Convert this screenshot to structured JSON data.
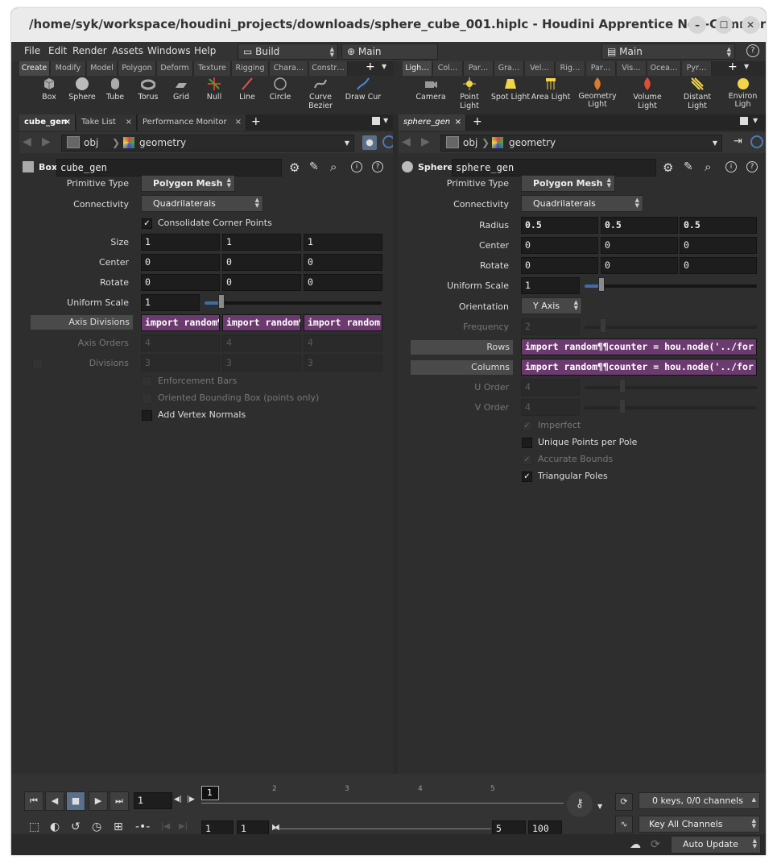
{
  "window": {
    "title": "/home/syk/workspace/houdini_projects/downloads/sphere_cube_001.hiplc - Houdini Apprentice Non-Commerci…",
    "minimize": "–",
    "maximize": "☐",
    "close": "✕"
  },
  "menu": [
    "File",
    "Edit",
    "Render",
    "Assets",
    "Windows",
    "Help"
  ],
  "desktop": "Build",
  "context": "Main",
  "context_right": "Main",
  "shelf_left": {
    "tabs": [
      "Create",
      "Modify",
      "Model",
      "Polygon",
      "Deform",
      "Texture",
      "Rigging",
      "Chara…",
      "Constr…"
    ],
    "tools": [
      "Box",
      "Sphere",
      "Tube",
      "Torus",
      "Grid",
      "Null",
      "Line",
      "Circle",
      "Curve Bezier",
      "Draw Cur"
    ]
  },
  "shelf_right": {
    "tabs": [
      "Ligh…",
      "Col…",
      "Par…",
      "Gra…",
      "Vel…",
      "Rig…",
      "Par…",
      "Vis…",
      "Ocea…",
      "Pyr…"
    ],
    "tools": [
      "Camera",
      "Point Light",
      "Spot Light",
      "Area Light",
      "Geometry Light",
      "Volume Light",
      "Distant Light",
      "Environ Ligh"
    ]
  },
  "left_panel": {
    "tabs": [
      "cube_gen",
      "Take List",
      "Performance Monitor"
    ],
    "path": [
      "obj",
      "geometry"
    ],
    "node_type": "Box",
    "node_name": "cube_gen",
    "params": {
      "primitive_type_label": "Primitive Type",
      "primitive_type": "Polygon Mesh",
      "connectivity_label": "Connectivity",
      "connectivity": "Quadrilaterals",
      "consolidate": "Consolidate Corner Points",
      "size_label": "Size",
      "size": [
        "1",
        "1",
        "1"
      ],
      "center_label": "Center",
      "center": [
        "0",
        "0",
        "0"
      ],
      "rotate_label": "Rotate",
      "rotate": [
        "0",
        "0",
        "0"
      ],
      "uniform_scale_label": "Uniform Scale",
      "uniform_scale": "1",
      "axis_divisions_label": "Axis Divisions",
      "axis_divisions": [
        "import random¶",
        "import random¶",
        "import random"
      ],
      "axis_orders_label": "Axis Orders",
      "axis_orders": [
        "4",
        "4",
        "4"
      ],
      "divisions_label": "Divisions",
      "divisions": [
        "3",
        "3",
        "3"
      ],
      "enforcement_bars": "Enforcement Bars",
      "oriented_bbox": "Oriented Bounding Box (points only)",
      "add_vertex_normals": "Add Vertex Normals"
    }
  },
  "right_panel": {
    "tabs": [
      "sphere_gen"
    ],
    "path": [
      "obj",
      "geometry"
    ],
    "node_type": "Sphere",
    "node_name": "sphere_gen",
    "params": {
      "primitive_type_label": "Primitive Type",
      "primitive_type": "Polygon Mesh",
      "connectivity_label": "Connectivity",
      "connectivity": "Quadrilaterals",
      "radius_label": "Radius",
      "radius": [
        "0.5",
        "0.5",
        "0.5"
      ],
      "center_label": "Center",
      "center": [
        "0",
        "0",
        "0"
      ],
      "rotate_label": "Rotate",
      "rotate": [
        "0",
        "0",
        "0"
      ],
      "uniform_scale_label": "Uniform Scale",
      "uniform_scale": "1",
      "orientation_label": "Orientation",
      "orientation": "Y Axis",
      "frequency_label": "Frequency",
      "frequency": "2",
      "rows_label": "Rows",
      "rows": "import random¶¶counter = hou.node('../for",
      "columns_label": "Columns",
      "columns": "import random¶¶counter = hou.node('../for",
      "u_order_label": "U Order",
      "u_order": "4",
      "v_order_label": "V Order",
      "v_order": "4",
      "imperfect": "Imperfect",
      "unique_points": "Unique Points per Pole",
      "accurate_bounds": "Accurate Bounds",
      "triangular_poles": "Triangular Poles"
    }
  },
  "timeline": {
    "current_frame": "1",
    "marker": "1",
    "ticks": [
      "2",
      "3",
      "4",
      "5"
    ],
    "start": "1",
    "start2": "1",
    "end": "5",
    "end2": "100",
    "keys_status": "0 keys, 0/0 channels",
    "key_all": "Key All Channels"
  },
  "status": {
    "auto_update": "Auto Update"
  },
  "colors": {
    "expr": "#6b3a6f",
    "bg": "#2e2e2e",
    "accent": "#3e6ea8"
  }
}
